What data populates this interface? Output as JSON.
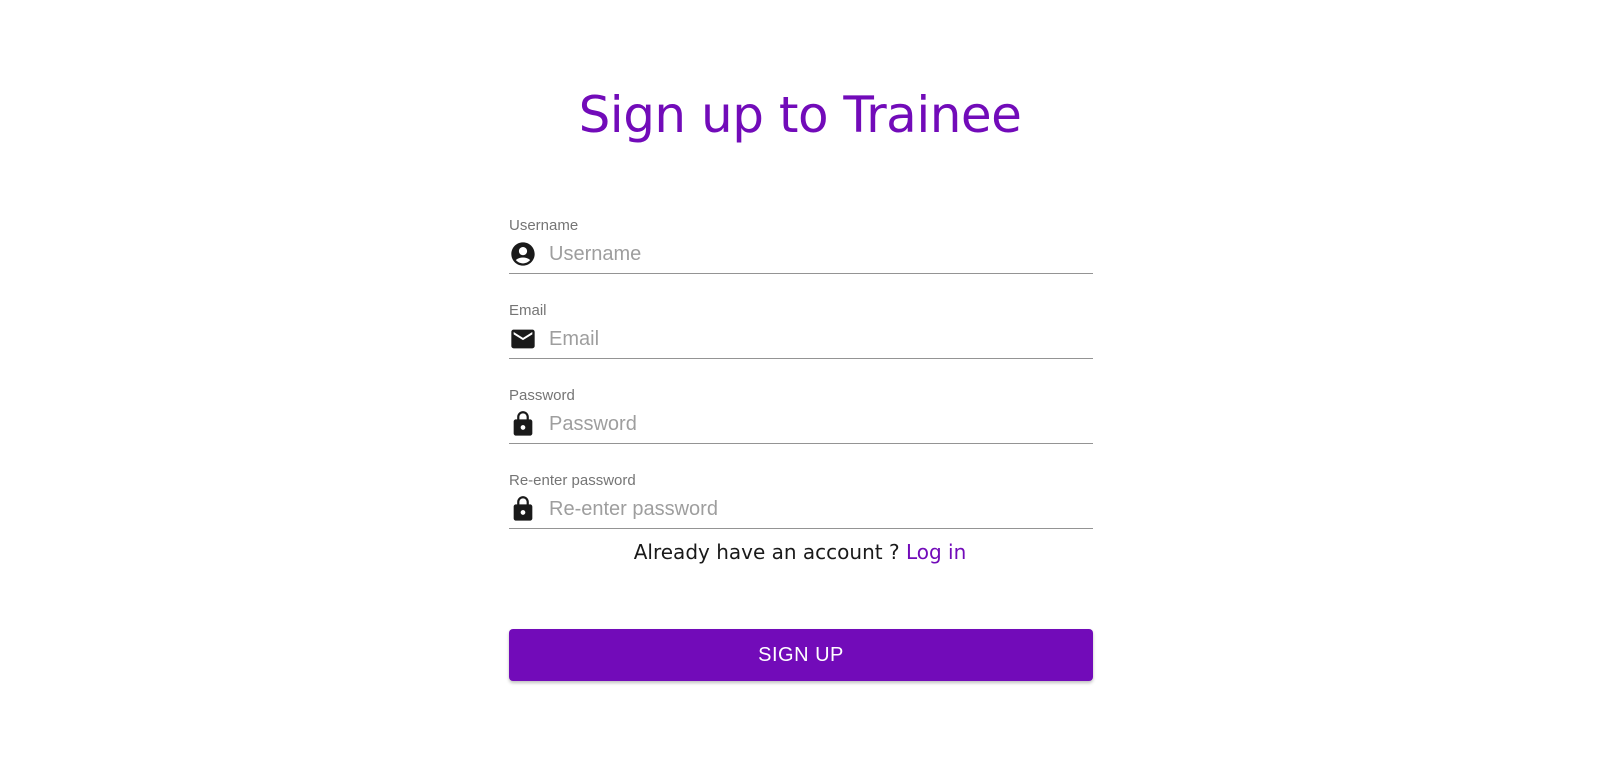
{
  "page": {
    "title": "Sign up to Trainee"
  },
  "form": {
    "fields": [
      {
        "label": "Username",
        "placeholder": "Username",
        "value": "",
        "icon": "account-circle-icon"
      },
      {
        "label": "Email",
        "placeholder": "Email",
        "value": "",
        "icon": "mail-icon"
      },
      {
        "label": "Password",
        "placeholder": "Password",
        "value": "",
        "icon": "lock-icon"
      },
      {
        "label": "Re-enter password",
        "placeholder": "Re-enter password",
        "value": "",
        "icon": "lock-icon"
      }
    ]
  },
  "login": {
    "prompt": "Already have an account ? ",
    "link_label": "Log in"
  },
  "signup": {
    "button_label": "SIGN UP"
  },
  "colors": {
    "accent": "#720bb9",
    "icon": "#1a1a1a",
    "label": "#757575",
    "placeholder": "#9e9e9e",
    "underline": "#949494"
  }
}
